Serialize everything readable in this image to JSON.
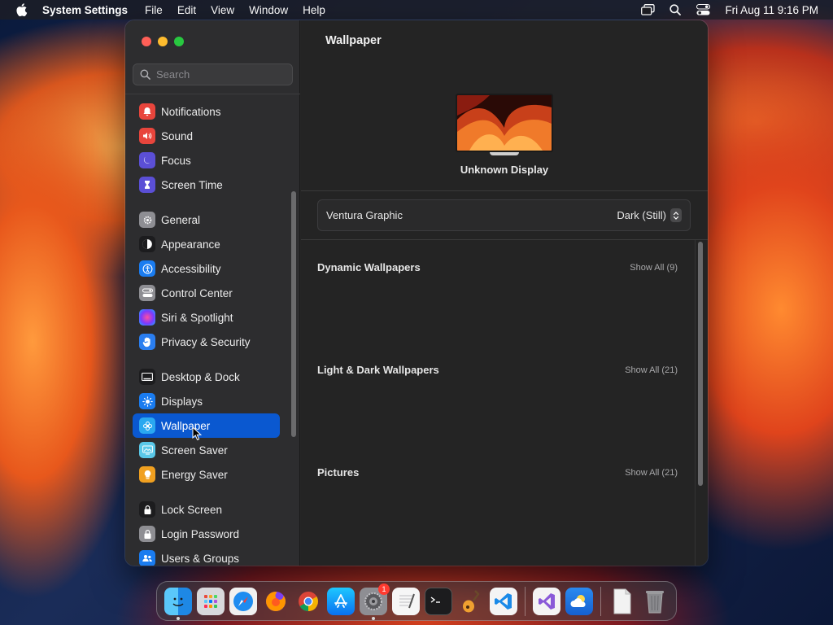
{
  "menubar": {
    "app_name": "System Settings",
    "menus": [
      "File",
      "Edit",
      "View",
      "Window",
      "Help"
    ],
    "clock": "Fri Aug 11  9:16 PM"
  },
  "window": {
    "title": "Wallpaper"
  },
  "sidebar": {
    "search_placeholder": "Search",
    "items": [
      {
        "label": "Notifications",
        "icon": "bell-icon",
        "color": "#e8453c"
      },
      {
        "label": "Sound",
        "icon": "speaker-icon",
        "color": "#e8453c"
      },
      {
        "label": "Focus",
        "icon": "moon-icon",
        "color": "#5b4fd6"
      },
      {
        "label": "Screen Time",
        "icon": "hourglass-icon",
        "color": "#5b4fd6"
      },
      {
        "label": "General",
        "icon": "gear-icon",
        "color": "#8e8e93"
      },
      {
        "label": "Appearance",
        "icon": "appearance-icon",
        "color": "#1c1c1e"
      },
      {
        "label": "Accessibility",
        "icon": "accessibility-icon",
        "color": "#1a7cf0"
      },
      {
        "label": "Control Center",
        "icon": "control-center-icon",
        "color": "#8e8e93"
      },
      {
        "label": "Siri & Spotlight",
        "icon": "siri-icon",
        "color": "#b03ad8"
      },
      {
        "label": "Privacy & Security",
        "icon": "hand-icon",
        "color": "#2a7ef0"
      },
      {
        "label": "Desktop & Dock",
        "icon": "dock-icon",
        "color": "#1c1c1e"
      },
      {
        "label": "Displays",
        "icon": "sun-icon",
        "color": "#1a7cf0"
      },
      {
        "label": "Wallpaper",
        "icon": "flower-icon",
        "color": "#2aa8f0"
      },
      {
        "label": "Screen Saver",
        "icon": "screen-saver-icon",
        "color": "#5ac8e8"
      },
      {
        "label": "Energy Saver",
        "icon": "battery-icon",
        "color": "#f0a020"
      },
      {
        "label": "Lock Screen",
        "icon": "lock-icon",
        "color": "#1c1c1e"
      },
      {
        "label": "Login Password",
        "icon": "lock-icon",
        "color": "#8e8e93"
      },
      {
        "label": "Users & Groups",
        "icon": "users-icon",
        "color": "#1a7cf0"
      }
    ],
    "selected": "Wallpaper"
  },
  "main": {
    "title": "Wallpaper",
    "display_name": "Unknown Display",
    "wallpaper_name": "Ventura Graphic",
    "wallpaper_style": "Dark (Still)",
    "sections": [
      {
        "title": "Dynamic Wallpapers",
        "link": "Show All (9)"
      },
      {
        "title": "Light & Dark Wallpapers",
        "link": "Show All (21)"
      },
      {
        "title": "Pictures",
        "link": "Show All (21)"
      }
    ]
  },
  "dock": {
    "apps": [
      {
        "name": "finder-icon",
        "running": true
      },
      {
        "name": "launchpad-icon",
        "running": false
      },
      {
        "name": "safari-icon",
        "running": false
      },
      {
        "name": "firefox-icon",
        "running": false
      },
      {
        "name": "chrome-icon",
        "running": false
      },
      {
        "name": "app-store-icon",
        "running": false
      },
      {
        "name": "system-settings-icon",
        "running": true,
        "badge": "1"
      },
      {
        "name": "textedit-icon",
        "running": false
      },
      {
        "name": "terminal-icon",
        "running": false
      },
      {
        "name": "garageband-icon",
        "running": false
      },
      {
        "name": "vscode-icon",
        "running": false
      },
      {
        "name": "visual-studio-icon",
        "running": false
      },
      {
        "name": "weather-icon",
        "running": false
      },
      {
        "name": "document-icon",
        "running": false
      },
      {
        "name": "trash-icon",
        "running": false
      }
    ]
  }
}
